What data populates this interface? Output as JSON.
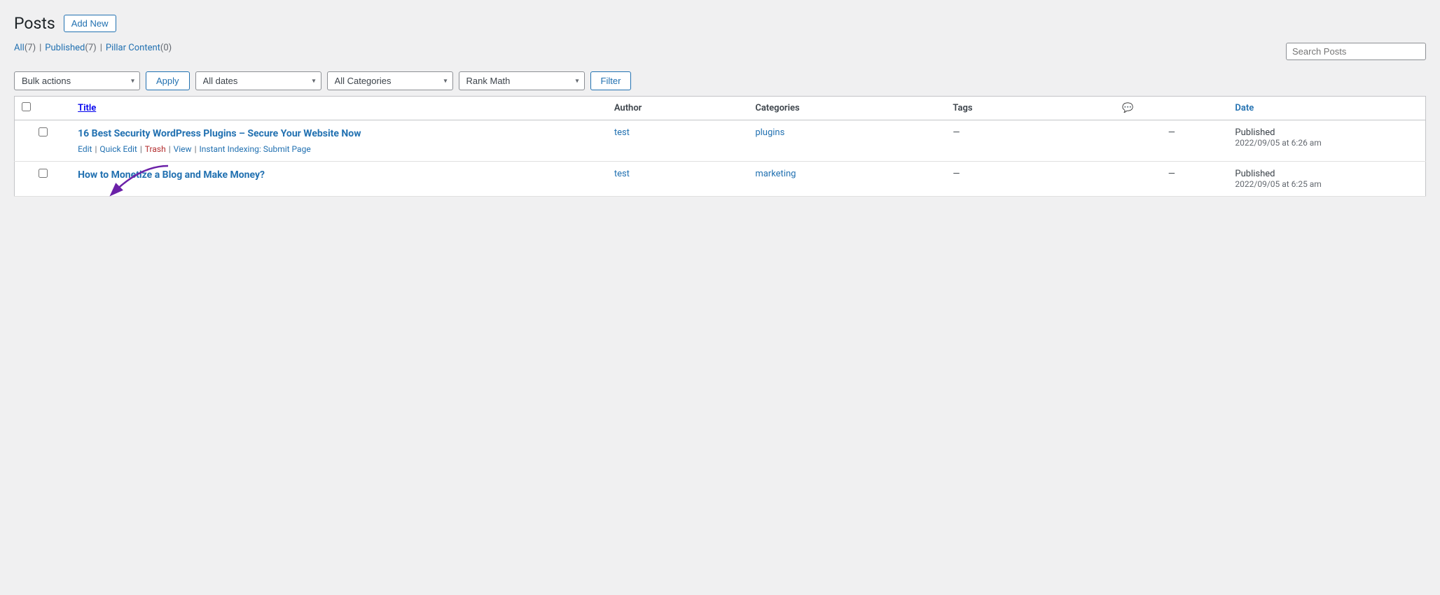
{
  "page": {
    "title": "Posts",
    "add_new_label": "Add New"
  },
  "filters": {
    "all_label": "All",
    "all_count": "(7)",
    "published_label": "Published",
    "published_count": "(7)",
    "pillar_label": "Pillar Content",
    "pillar_count": "(0)",
    "bulk_actions_placeholder": "Bulk actions",
    "apply_label": "Apply",
    "dates_placeholder": "All dates",
    "categories_placeholder": "All Categories",
    "rankmath_placeholder": "Rank Math",
    "filter_label": "Filter"
  },
  "table": {
    "headers": {
      "title": "Title",
      "author": "Author",
      "categories": "Categories",
      "tags": "Tags",
      "comments": "💬",
      "date": "Date"
    },
    "rows": [
      {
        "id": 1,
        "title": "16 Best Security WordPress Plugins – Secure Your Website Now",
        "author": "test",
        "categories": "plugins",
        "tags": "—",
        "comments": "—",
        "status": "Published",
        "date": "2022/09/05 at 6:26 am",
        "actions": {
          "edit": "Edit",
          "quick_edit": "Quick Edit",
          "trash": "Trash",
          "view": "View",
          "instant_indexing": "Instant Indexing: Submit Page"
        }
      },
      {
        "id": 2,
        "title": "How to Monetize a Blog and Make Money?",
        "author": "test",
        "categories": "marketing",
        "tags": "—",
        "comments": "—",
        "status": "Published",
        "date": "2022/09/05 at 6:25 am",
        "actions": {}
      }
    ]
  },
  "search": {
    "placeholder": "Search Posts"
  }
}
